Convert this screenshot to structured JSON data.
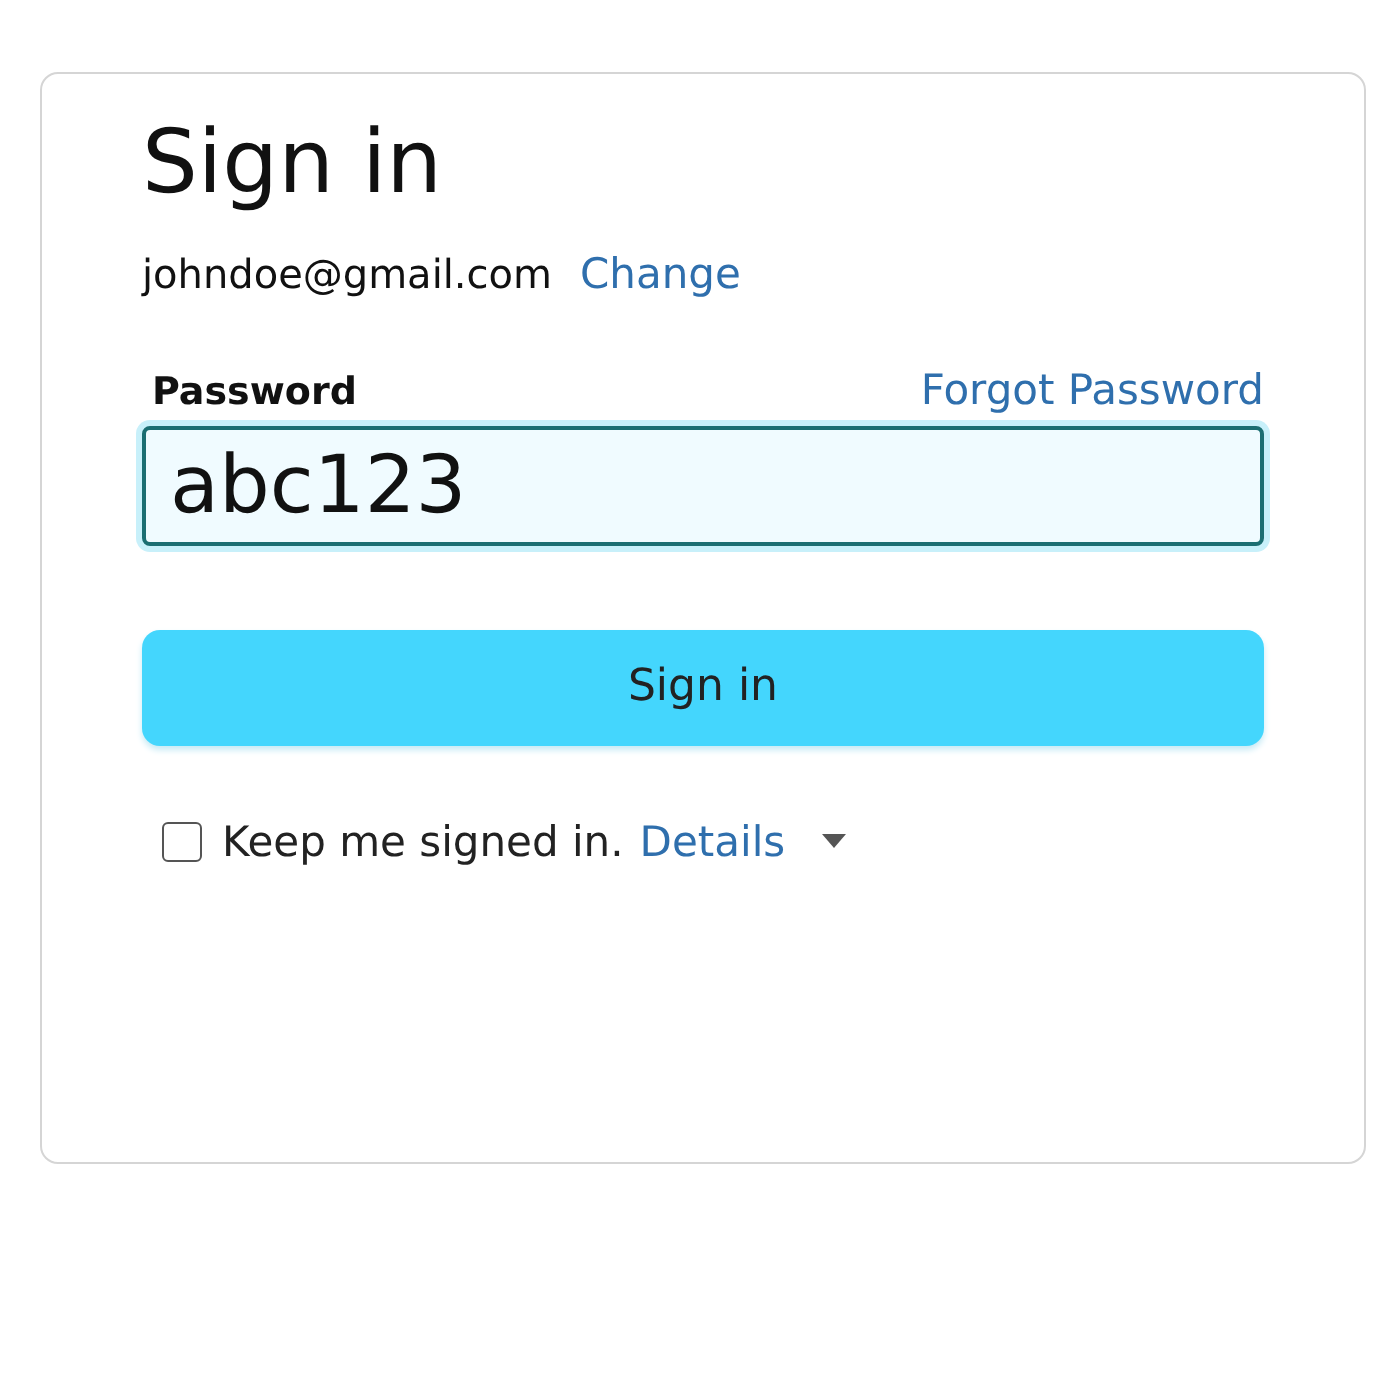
{
  "title": "Sign in",
  "account": {
    "email": "johndoe@gmail.com",
    "change_link": "Change"
  },
  "password": {
    "label": "Password",
    "forgot_link": "Forgot Password",
    "value": "abc123",
    "focused": true
  },
  "submit_button": "Sign in",
  "keep_signed_in": {
    "label": "Keep me signed in.",
    "checked": false,
    "details_link": "Details",
    "expanded": false
  }
}
